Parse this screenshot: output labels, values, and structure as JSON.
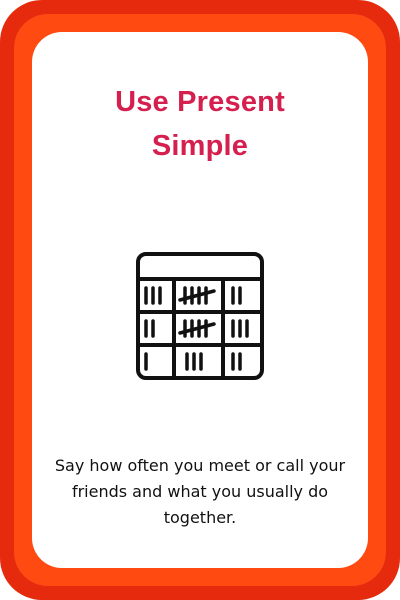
{
  "card": {
    "title_line1": "Use Present",
    "title_line2": "Simple",
    "icon": "tally-table-icon",
    "instruction": "Say how often you meet or call your friends and what you usually do together."
  },
  "colors": {
    "outer_border": "#e62a0e",
    "inner_ring": "#ff4a12",
    "card_background": "#ffffff",
    "title": "#d41f4f",
    "text": "#111111"
  }
}
